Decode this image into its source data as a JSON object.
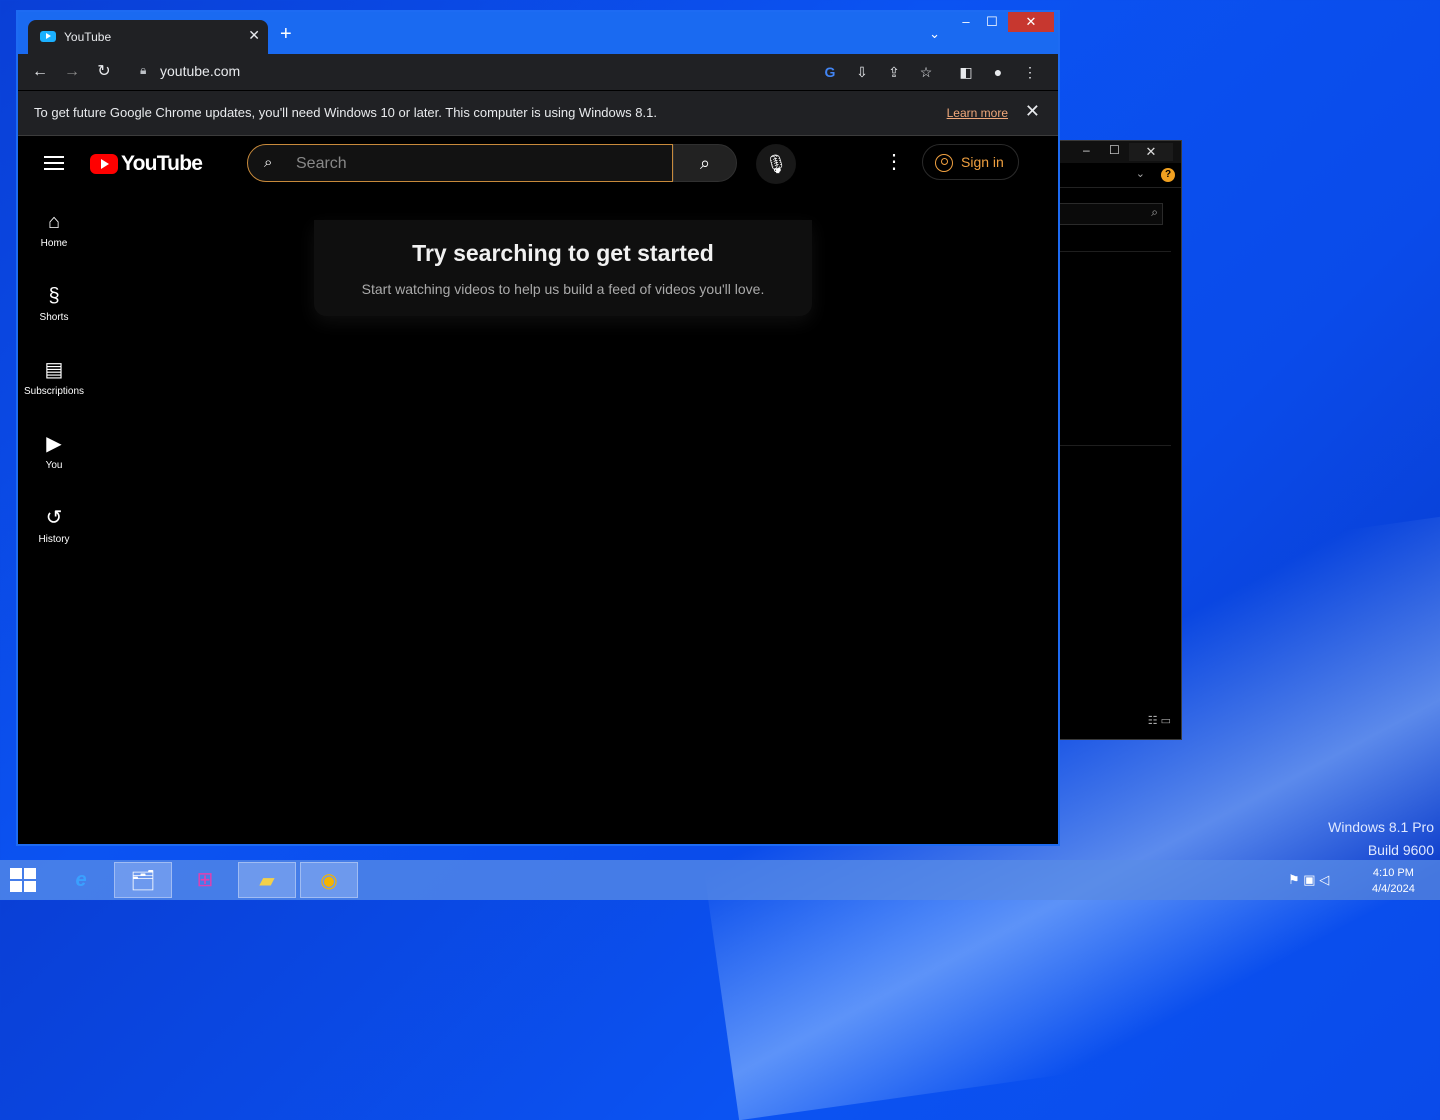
{
  "browser": {
    "tab_title": "YouTube",
    "url": "youtube.com",
    "infobar": {
      "message": "To get future Google Chrome updates, you'll need Windows 10 or later. This computer is using Windows 8.1.",
      "link": "Learn more"
    }
  },
  "youtube": {
    "logo_text": "YouTube",
    "search_placeholder": "Search",
    "sign_in": "Sign in",
    "sidebar": [
      {
        "label": "Home",
        "icon": "home-icon"
      },
      {
        "label": "Shorts",
        "icon": "shorts-icon"
      },
      {
        "label": "Subscriptions",
        "icon": "subscriptions-icon"
      },
      {
        "label": "You",
        "icon": "you-icon"
      },
      {
        "label": "History",
        "icon": "history-icon"
      }
    ],
    "empty_title": "Try searching to get started",
    "empty_subtitle": "Start watching videos to help us build a feed of videos you'll love."
  },
  "os": {
    "edition": "Windows 8.1 Pro",
    "build": "Build 9600",
    "time": "4:10 PM",
    "date": "4/4/2024"
  },
  "colors": {
    "youtube_red": "#ff0000",
    "signin_accent": "#f0a040",
    "desktop_blue": "#0b53f2"
  }
}
